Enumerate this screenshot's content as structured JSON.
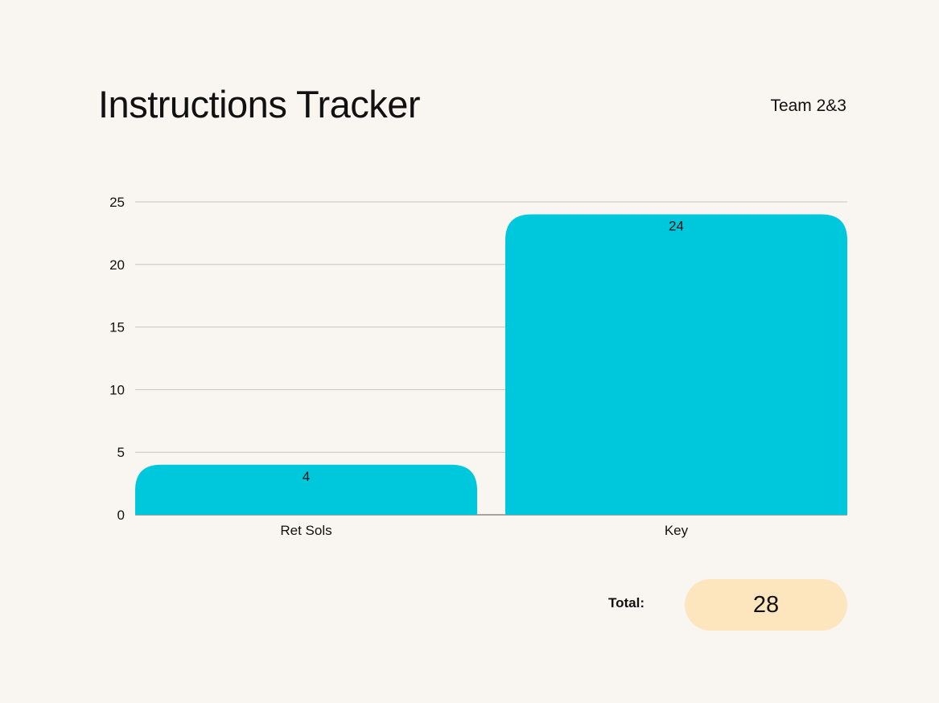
{
  "header": {
    "title": "Instructions Tracker",
    "team": "Team 2&3"
  },
  "total": {
    "label": "Total:",
    "value": "28"
  },
  "colors": {
    "bar": "#00c8dc",
    "background": "#f9f6f1",
    "gridline": "#c4c4c4",
    "total_pill": "#fde5bd"
  },
  "chart_data": {
    "type": "bar",
    "categories": [
      "Ret Sols",
      "Key"
    ],
    "values": [
      4,
      24
    ],
    "data_labels": [
      "4",
      "24"
    ],
    "ylim": [
      0,
      25
    ],
    "yticks": [
      0,
      5,
      10,
      15,
      20,
      25
    ],
    "grid": true,
    "title": "",
    "xlabel": "",
    "ylabel": ""
  }
}
